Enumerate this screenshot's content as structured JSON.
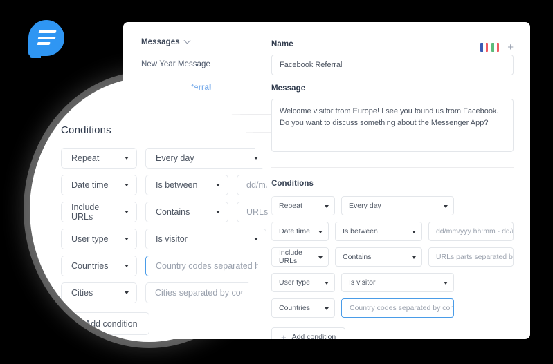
{
  "app": {
    "logo_name": "messenger-chat-bubble-logo"
  },
  "sidebar": {
    "header": "Messages",
    "items": [
      {
        "label": "New Year Message",
        "active": false
      },
      {
        "label": "Facebook Referral",
        "active": true
      }
    ]
  },
  "form": {
    "name_label": "Name",
    "name_value": "Facebook Referral",
    "name_placeholder": "Name",
    "message_label": "Message",
    "message_value": "Welcome visitor from Europe! I see you found us from Facebook. Do you want to discuss something about the Messenger App?",
    "message_placeholder": "Message",
    "add_language_label": "+",
    "languages": [
      {
        "name": "french-flag",
        "colors": [
          "#3b5bb5",
          "#ffffff",
          "#ef5a62"
        ]
      },
      {
        "name": "italian-flag",
        "colors": [
          "#5cbb7a",
          "#ffffff",
          "#ef5a62"
        ]
      }
    ]
  },
  "conditions": {
    "title": "Conditions",
    "add_label": "Add condition",
    "rows": [
      {
        "type": "Repeat",
        "operator": "Every day",
        "value_placeholder": null
      },
      {
        "type": "Date time",
        "operator": "Is between",
        "value_placeholder": "dd/mm/yyy hh:mm - dd/mm/yyy hh:mm"
      },
      {
        "type": "Include URLs",
        "operator": "Contains",
        "value_placeholder": "URLs parts separated by commas"
      },
      {
        "type": "User type",
        "operator": "Is visitor",
        "value_placeholder": null
      },
      {
        "type": "Countries",
        "operator": null,
        "value_placeholder": "Country codes separated by commas",
        "focused": true
      }
    ]
  },
  "magnifier": {
    "title": "Conditions",
    "add_label": "Add condition",
    "rows": [
      {
        "type": "Repeat",
        "operator": "Every day",
        "value_placeholder": null
      },
      {
        "type": "Date time",
        "operator": "Is between",
        "value_placeholder": "dd/mm/yyy hh:mm - dd/mm/yyy"
      },
      {
        "type": "Include URLs",
        "operator": "Contains",
        "value_placeholder": "URLs parts separated by commas"
      },
      {
        "type": "User type",
        "operator": "Is visitor",
        "value_placeholder": null
      },
      {
        "type": "Countries",
        "operator": null,
        "value_placeholder": "Country codes separated by commas",
        "focused": true
      },
      {
        "type": "Cities",
        "operator": null,
        "value_placeholder": "Cities separated by commas"
      }
    ]
  },
  "colors": {
    "accent": "#2f96f3",
    "focus_border": "#4a9ce8",
    "active_link": "#2f7fe0",
    "background": "#000000",
    "card": "#ffffff"
  }
}
